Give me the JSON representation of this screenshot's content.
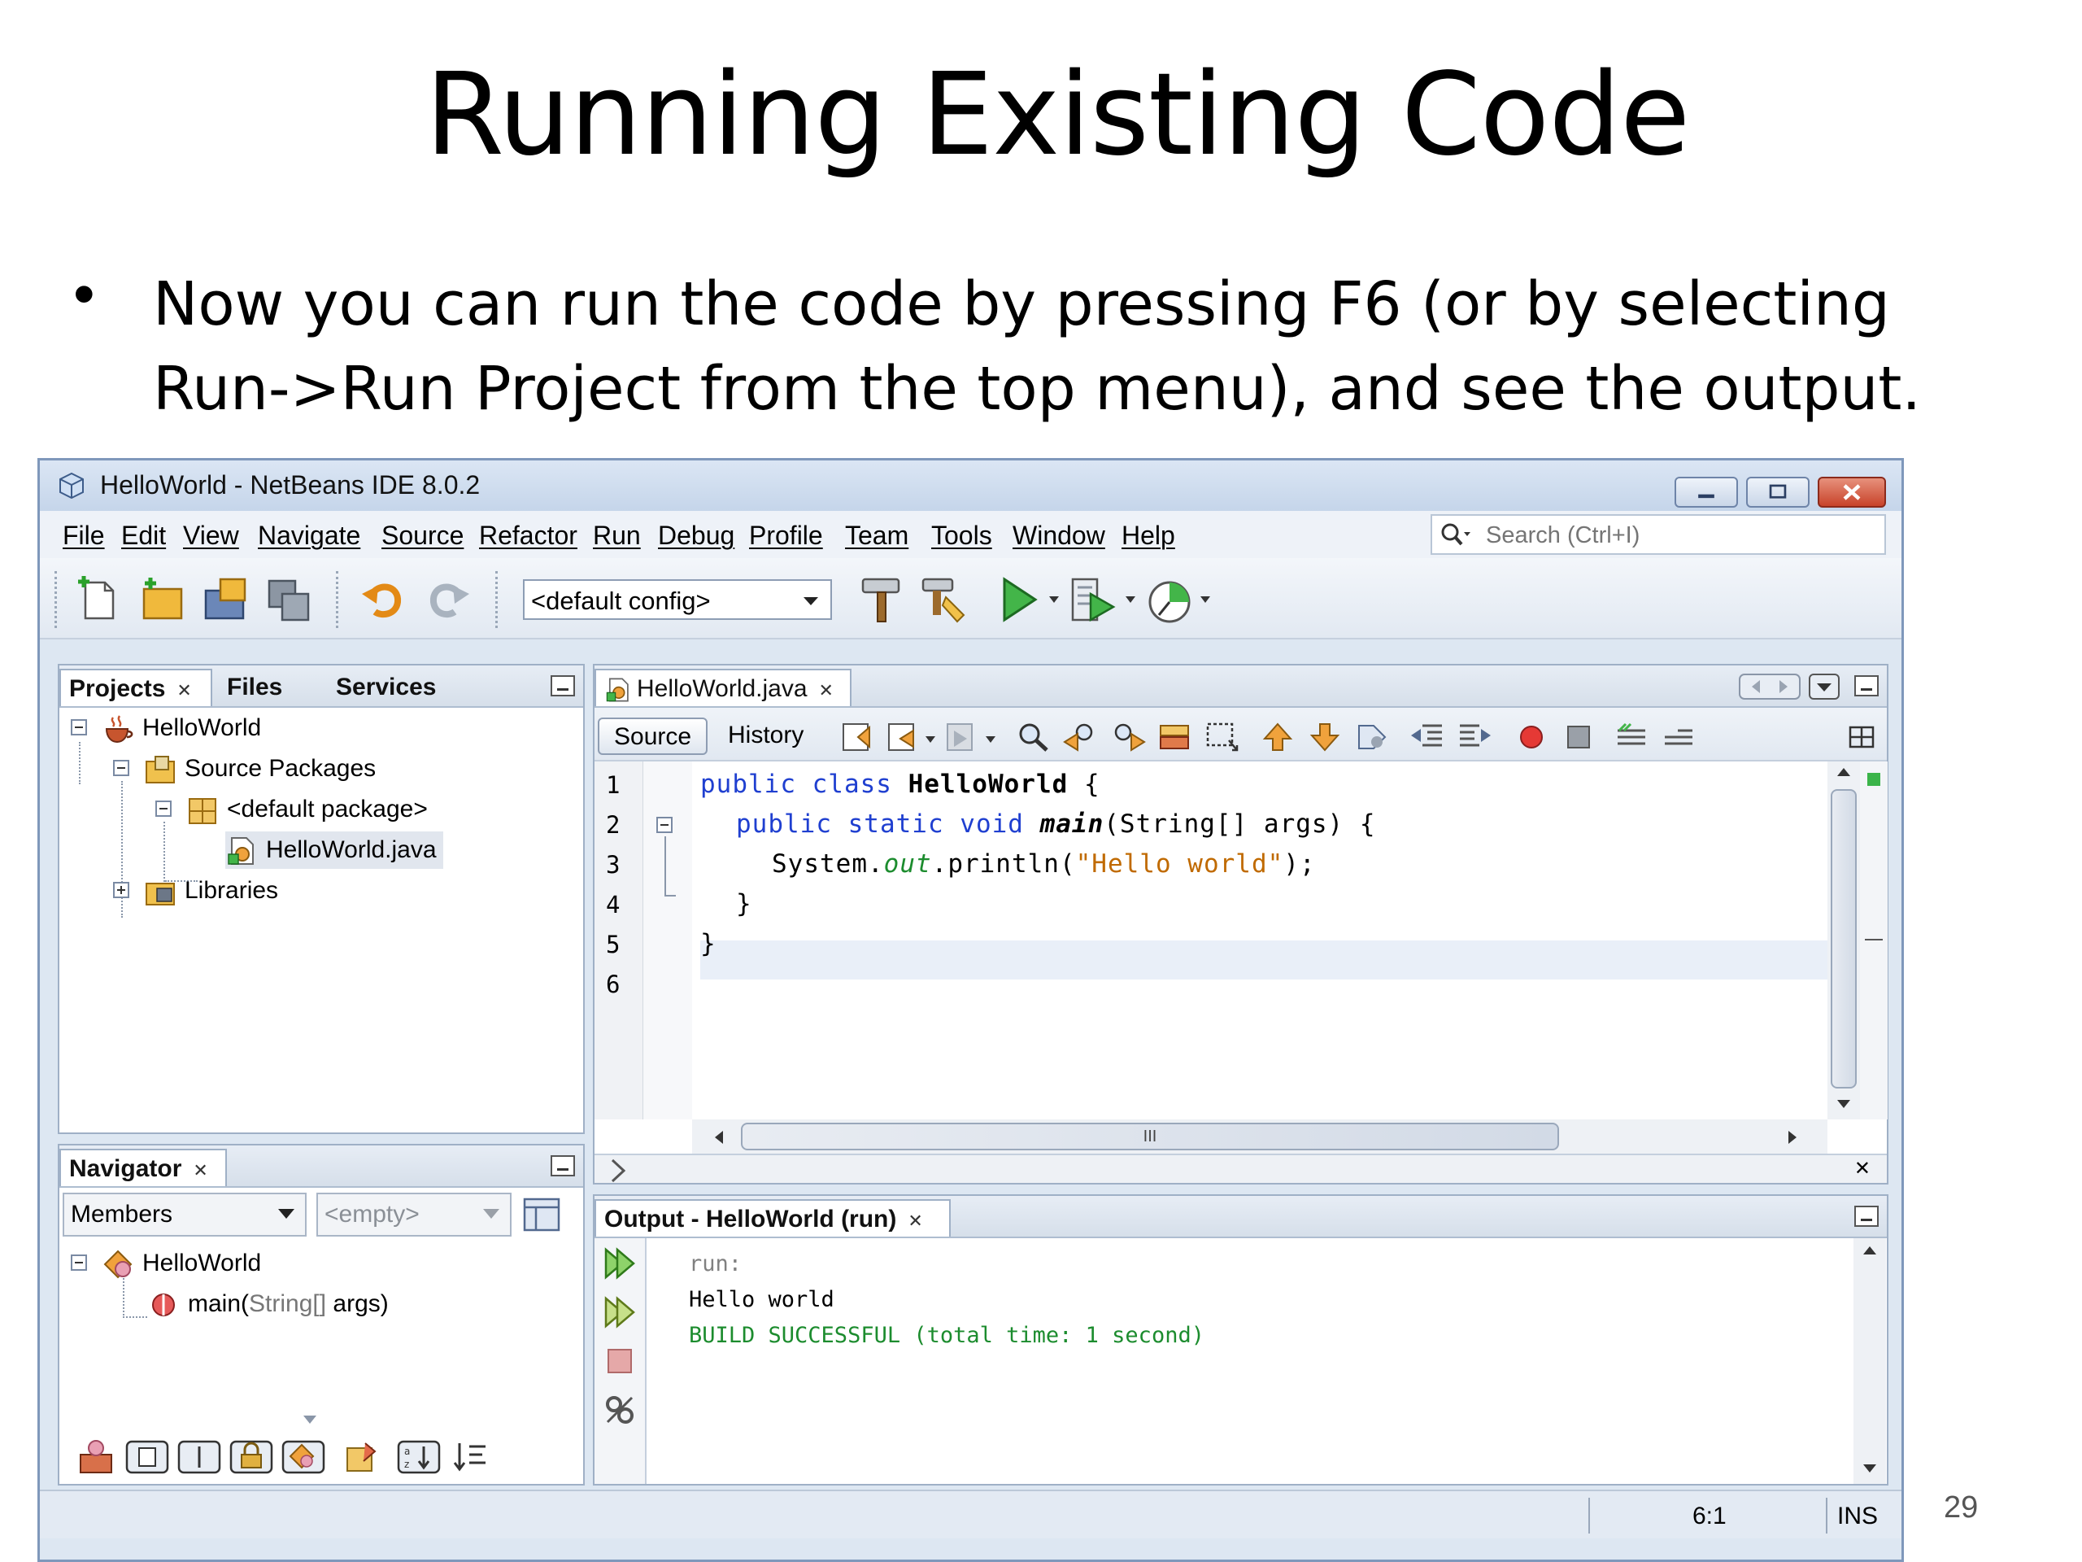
{
  "slide": {
    "title": "Running Existing Code",
    "bullet_symbol": "•",
    "bullet_text": "Now you can run the code by pressing F6 (or by selecting Run->Run Project from the top menu), and see the output.",
    "page_number": "29"
  },
  "window": {
    "title": "HelloWorld - NetBeans IDE 8.0.2"
  },
  "menu": [
    "File",
    "Edit",
    "View",
    "Navigate",
    "Source",
    "Refactor",
    "Run",
    "Debug",
    "Profile",
    "Team",
    "Tools",
    "Window",
    "Help"
  ],
  "search": {
    "placeholder": "Search (Ctrl+I)"
  },
  "toolbar": {
    "config_value": "<default config>"
  },
  "projects_panel": {
    "tabs": [
      "Projects",
      "Files",
      "Services"
    ],
    "tree": {
      "project": "HelloWorld",
      "source_packages": "Source Packages",
      "default_package": "<default package>",
      "file": "HelloWorld.java",
      "libraries": "Libraries"
    }
  },
  "navigator_panel": {
    "tab": "Navigator",
    "members_value": "Members",
    "filter_value": "<empty>",
    "tree": {
      "class": "HelloWorld",
      "method_name": "main(",
      "method_params": "String[]",
      "method_rest": " args)"
    }
  },
  "editor": {
    "file_tab": "HelloWorld.java",
    "source_tab": "Source",
    "history_tab": "History",
    "line_numbers": [
      "1",
      "2",
      "3",
      "4",
      "5",
      "6"
    ],
    "code": {
      "l1_kw": "public class ",
      "l1_name": "HelloWorld",
      "l1_end": " {",
      "l2_kw": "public static void ",
      "l2_name": "main",
      "l2_end": "(String[] args) {",
      "l3_a": "System.",
      "l3_field": "out",
      "l3_b": ".println(",
      "l3_str": "\"Hello world\"",
      "l3_end": ");",
      "l4": "}",
      "l5": "}"
    },
    "hscroll_mark": "III"
  },
  "output_panel": {
    "tab": "Output - HelloWorld (run)",
    "lines": [
      "run:",
      "Hello world",
      "BUILD SUCCESSFUL (total time: 1 second)"
    ]
  },
  "status": {
    "position": "6:1",
    "mode": "INS"
  },
  "colors": {
    "keyword": "#1f3fd0",
    "string": "#c06a00",
    "field": "#1c8c2e",
    "success": "#1c8c2e",
    "comment": "#808080"
  }
}
